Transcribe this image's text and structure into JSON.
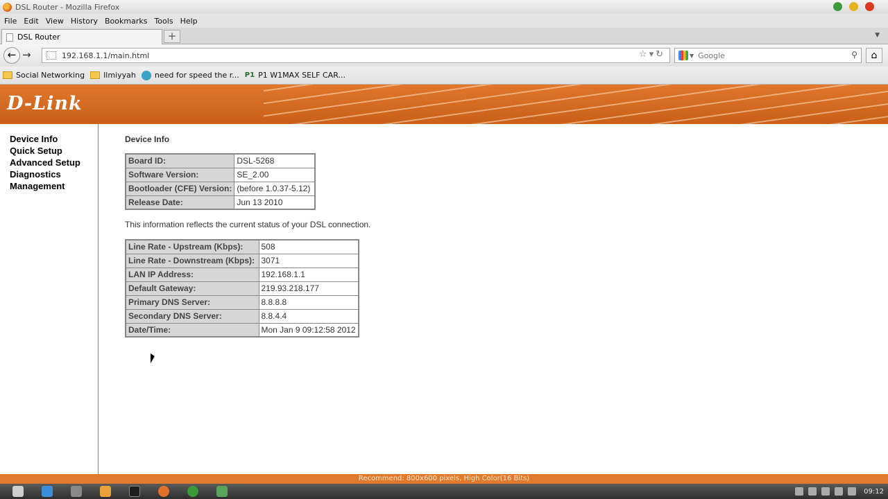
{
  "window": {
    "title": "DSL Router - Mozilla Firefox"
  },
  "menu": [
    "File",
    "Edit",
    "View",
    "History",
    "Bookmarks",
    "Tools",
    "Help"
  ],
  "tab": {
    "label": "DSL Router",
    "new_tab_symbol": "+"
  },
  "nav": {
    "url": "192.168.1.1/main.html",
    "search_placeholder": "Google"
  },
  "bookmarks": [
    "Social Networking",
    "Ilmiyyah",
    "need for speed the r...",
    "P1 W1MAX SELF CAR..."
  ],
  "brand": {
    "logo": "D-Link",
    "banner_color": "#e0772c"
  },
  "sidebar": {
    "items": [
      "Device Info",
      "Quick Setup",
      "Advanced Setup",
      "Diagnostics",
      "Management"
    ]
  },
  "page": {
    "heading": "Device Info",
    "device_rows": [
      {
        "label": "Board ID:",
        "value": "DSL-5268"
      },
      {
        "label": "Software Version:",
        "value": "SE_2.00"
      },
      {
        "label": "Bootloader (CFE) Version:",
        "value": "(before 1.0.37-5.12)"
      },
      {
        "label": "Release Date:",
        "value": "Jun 13 2010"
      }
    ],
    "note": "This information reflects the current status of your DSL connection.",
    "status_rows": [
      {
        "label": "Line Rate - Upstream (Kbps):",
        "value": "508"
      },
      {
        "label": "Line Rate - Downstream (Kbps):",
        "value": "3071"
      },
      {
        "label": "LAN IP Address:",
        "value": "192.168.1.1"
      },
      {
        "label": "Default Gateway:",
        "value": "219.93.218.177"
      },
      {
        "label": "Primary DNS Server:",
        "value": "8.8.8.8"
      },
      {
        "label": "Secondary DNS Server:",
        "value": "8.8.4.4"
      },
      {
        "label": "Date/Time:",
        "value": "Mon Jan 9 09:12:58 2012"
      }
    ]
  },
  "footer": {
    "text": "Recommend: 800x600 pixels, High Color(16 Bits)"
  },
  "taskbar": {
    "clock": "09:12"
  }
}
